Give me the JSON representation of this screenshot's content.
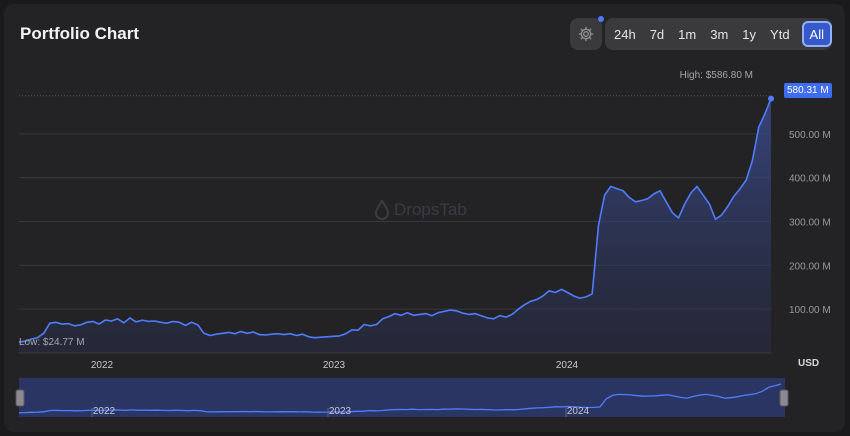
{
  "header": {
    "title": "Portfolio Chart",
    "ranges": [
      "24h",
      "7d",
      "1m",
      "3m",
      "1y",
      "Ytd",
      "All"
    ],
    "active_range": "All"
  },
  "icons": {
    "settings": "gear-icon",
    "watermark": "drop-icon"
  },
  "watermark": "DropsTab",
  "colors": {
    "line": "#4f7cff",
    "badge": "#3f6df2",
    "background": "#232325"
  },
  "annotations": {
    "high": "High: $586.80 M",
    "low": "Low: $24.77 M",
    "current": "580.31 M",
    "currency": "USD"
  },
  "chart_data": {
    "type": "area",
    "y_tick_labels": [
      "100.00 M",
      "200.00 M",
      "300.00 M",
      "400.00 M",
      "500.00 M"
    ],
    "x_tick_labels": [
      "2022",
      "2023",
      "2024"
    ],
    "ylim": [
      0,
      600
    ],
    "grid": true,
    "series": [
      {
        "values": [
          24.77,
          27,
          32,
          35,
          45,
          68,
          70,
          66,
          67,
          62,
          64,
          70,
          72,
          66,
          75,
          73,
          78,
          69,
          80,
          71,
          75,
          72,
          73,
          70,
          68,
          72,
          70,
          63,
          70,
          64,
          45,
          40,
          43,
          45,
          47,
          44,
          49,
          45,
          48,
          42,
          41,
          43,
          44,
          42,
          44,
          40,
          43,
          37,
          35,
          36,
          37,
          38,
          39,
          44,
          53,
          52,
          65,
          62,
          65,
          78,
          83,
          90,
          86,
          92,
          86,
          88,
          90,
          85,
          92,
          95,
          98,
          96,
          91,
          88,
          90,
          85,
          80,
          78,
          85,
          82,
          88,
          100,
          110,
          118,
          122,
          130,
          142,
          138,
          145,
          138,
          130,
          125,
          128,
          135,
          290,
          360,
          380,
          375,
          370,
          355,
          345,
          348,
          352,
          363,
          370,
          345,
          320,
          308,
          340,
          365,
          380,
          360,
          340,
          305,
          315,
          335,
          358,
          375,
          395,
          440,
          515,
          545,
          580.31
        ]
      }
    ],
    "navigator_tick_labels": [
      "2022",
      "2023",
      "2024"
    ]
  }
}
